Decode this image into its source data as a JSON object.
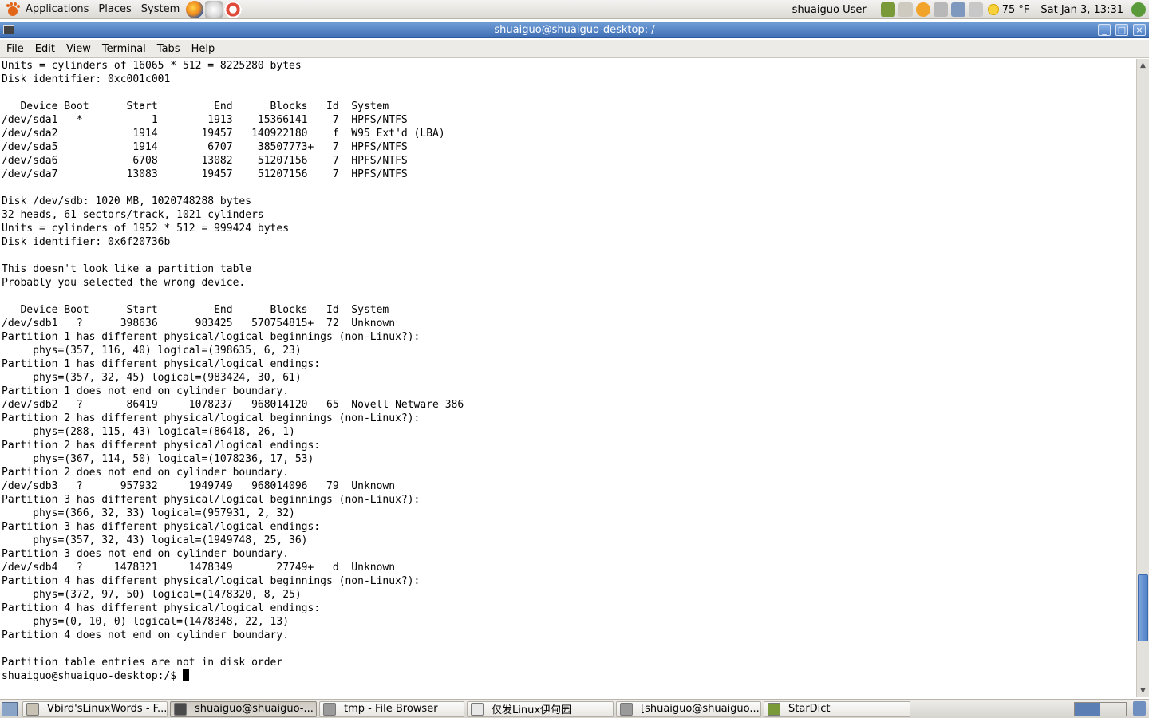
{
  "top_panel": {
    "menus": [
      "Applications",
      "Places",
      "System"
    ],
    "user": "shuaiguo User",
    "temperature": "75 °F",
    "clock": "Sat Jan  3, 13:31",
    "icons": [
      "gnome-foot-icon",
      "firefox-icon",
      "mail-icon",
      "help-icon"
    ]
  },
  "window": {
    "title": "shuaiguo@shuaiguo-desktop: /",
    "controls": {
      "minimize": "_",
      "maximize": "□",
      "close": "×"
    }
  },
  "menubar": [
    {
      "acc": "F",
      "rest": "ile"
    },
    {
      "acc": "E",
      "rest": "dit"
    },
    {
      "acc": "V",
      "rest": "iew"
    },
    {
      "acc": "T",
      "rest": "erminal"
    },
    {
      "acc": "",
      "pre": "Ta",
      "accmid": "b",
      "post": "s"
    },
    {
      "acc": "H",
      "rest": "elp"
    }
  ],
  "terminal": {
    "lines": [
      "Units = cylinders of 16065 * 512 = 8225280 bytes",
      "Disk identifier: 0xc001c001",
      "",
      "   Device Boot      Start         End      Blocks   Id  System",
      "/dev/sda1   *           1        1913    15366141    7  HPFS/NTFS",
      "/dev/sda2            1914       19457   140922180    f  W95 Ext'd (LBA)",
      "/dev/sda5            1914        6707    38507773+   7  HPFS/NTFS",
      "/dev/sda6            6708       13082    51207156    7  HPFS/NTFS",
      "/dev/sda7           13083       19457    51207156    7  HPFS/NTFS",
      "",
      "Disk /dev/sdb: 1020 MB, 1020748288 bytes",
      "32 heads, 61 sectors/track, 1021 cylinders",
      "Units = cylinders of 1952 * 512 = 999424 bytes",
      "Disk identifier: 0x6f20736b",
      "",
      "This doesn't look like a partition table",
      "Probably you selected the wrong device.",
      "",
      "   Device Boot      Start         End      Blocks   Id  System",
      "/dev/sdb1   ?      398636      983425   570754815+  72  Unknown",
      "Partition 1 has different physical/logical beginnings (non-Linux?):",
      "     phys=(357, 116, 40) logical=(398635, 6, 23)",
      "Partition 1 has different physical/logical endings:",
      "     phys=(357, 32, 45) logical=(983424, 30, 61)",
      "Partition 1 does not end on cylinder boundary.",
      "/dev/sdb2   ?       86419     1078237   968014120   65  Novell Netware 386",
      "Partition 2 has different physical/logical beginnings (non-Linux?):",
      "     phys=(288, 115, 43) logical=(86418, 26, 1)",
      "Partition 2 has different physical/logical endings:",
      "     phys=(367, 114, 50) logical=(1078236, 17, 53)",
      "Partition 2 does not end on cylinder boundary.",
      "/dev/sdb3   ?      957932     1949749   968014096   79  Unknown",
      "Partition 3 has different physical/logical beginnings (non-Linux?):",
      "     phys=(366, 32, 33) logical=(957931, 2, 32)",
      "Partition 3 has different physical/logical endings:",
      "     phys=(357, 32, 43) logical=(1949748, 25, 36)",
      "Partition 3 does not end on cylinder boundary.",
      "/dev/sdb4   ?     1478321     1478349       27749+   d  Unknown",
      "Partition 4 has different physical/logical beginnings (non-Linux?):",
      "     phys=(372, 97, 50) logical=(1478320, 8, 25)",
      "Partition 4 has different physical/logical endings:",
      "     phys=(0, 10, 0) logical=(1478348, 22, 13)",
      "Partition 4 does not end on cylinder boundary.",
      "",
      "Partition table entries are not in disk order",
      "shuaiguo@shuaiguo-desktop:/$ "
    ],
    "scroll_position": 0.92
  },
  "taskbar": {
    "tasks": [
      {
        "label": "Vbird'sLinuxWords - F...",
        "color": "#c8c2b4",
        "active": false
      },
      {
        "label": "shuaiguo@shuaiguo-...",
        "color": "#4a4a4a",
        "active": true
      },
      {
        "label": "tmp - File Browser",
        "color": "#9a9a9a",
        "active": false
      },
      {
        "label": "仅发Linux伊甸园",
        "color": "#e8e8e8",
        "active": false
      },
      {
        "label": "[shuaiguo@shuaiguo...",
        "color": "#9a9a9a",
        "active": false
      },
      {
        "label": "StarDict",
        "color": "#7a9a3a",
        "active": false
      }
    ]
  },
  "colors": {
    "titlebar": "#4a7bc2",
    "accent": "#5b7fb4"
  }
}
